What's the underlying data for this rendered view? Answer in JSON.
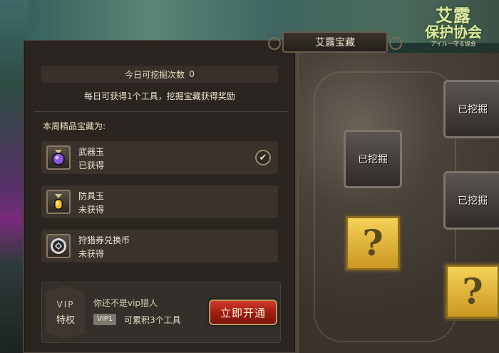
{
  "window": {
    "title": "艾露宝藏"
  },
  "logo": {
    "line1": "艾露",
    "line2": "保护协会",
    "sub": "アイルー守る協会"
  },
  "dig": {
    "label": "今日可挖掘次数",
    "count": "0"
  },
  "daily_note": "每日可获得1个工具，挖掘宝藏获得奖励",
  "week_label": "本周精品宝藏为:",
  "items": [
    {
      "name": "武器玉",
      "state": "已获得",
      "icon": "purple-orb-icon",
      "checked": true
    },
    {
      "name": "防具玉",
      "state": "未获得",
      "icon": "yellow-gem-icon",
      "checked": false
    },
    {
      "name": "狩猎券兑换币",
      "state": "未获得",
      "icon": "coin-icon",
      "checked": false
    }
  ],
  "vip": {
    "badge_top": "VIP",
    "badge_bottom": "特权",
    "notice": "你还不是vip猎人",
    "tag": "VIP1",
    "accumulate": "可累积3个工具",
    "button": "立即开通"
  },
  "map": {
    "dug_label": "已挖掘",
    "unknown_symbol": "?"
  },
  "colors": {
    "accent": "#c8951e",
    "button": "#9c1d12",
    "panel": "#2a2521"
  }
}
